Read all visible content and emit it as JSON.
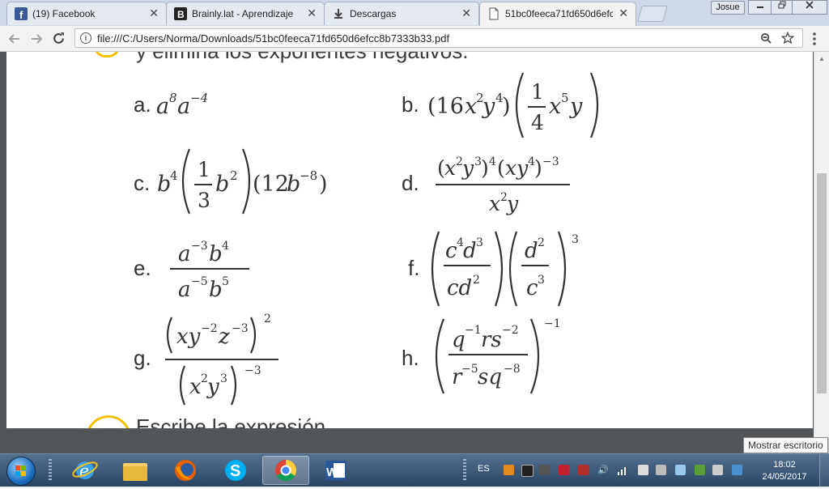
{
  "browser": {
    "tabs": [
      {
        "title": "(19) Facebook",
        "icon": "facebook-icon"
      },
      {
        "title": "Brainly.lat - Aprendizaje",
        "icon": "brainly-icon"
      },
      {
        "title": "Descargas",
        "icon": "download-icon"
      },
      {
        "title": "51bc0feeca71fd650d6efc",
        "icon": "document-icon",
        "active": true
      }
    ],
    "close_glyph": "✕",
    "window_user": "Josue",
    "address": "file:///C:/Users/Norma/Downloads/51bc0feeca71fd650d6efcc8b7333b33.pdf"
  },
  "document": {
    "cut_heading": "y elimina los exponentes negativos.",
    "cut_footer": "Escribe la expresión",
    "exercises": [
      {
        "label": "a."
      },
      {
        "label": "b."
      },
      {
        "label": "c."
      },
      {
        "label": "d."
      },
      {
        "label": "e."
      },
      {
        "label": "f."
      },
      {
        "label": "g."
      },
      {
        "label": "h."
      }
    ]
  },
  "tooltip": "Mostrar escritorio",
  "taskbar": {
    "language": "ES",
    "time": "18:02",
    "date": "24/05/2017",
    "pinned": [
      "internet-explorer-icon",
      "file-explorer-icon",
      "firefox-icon",
      "skype-icon",
      "chrome-icon",
      "word-icon"
    ]
  }
}
